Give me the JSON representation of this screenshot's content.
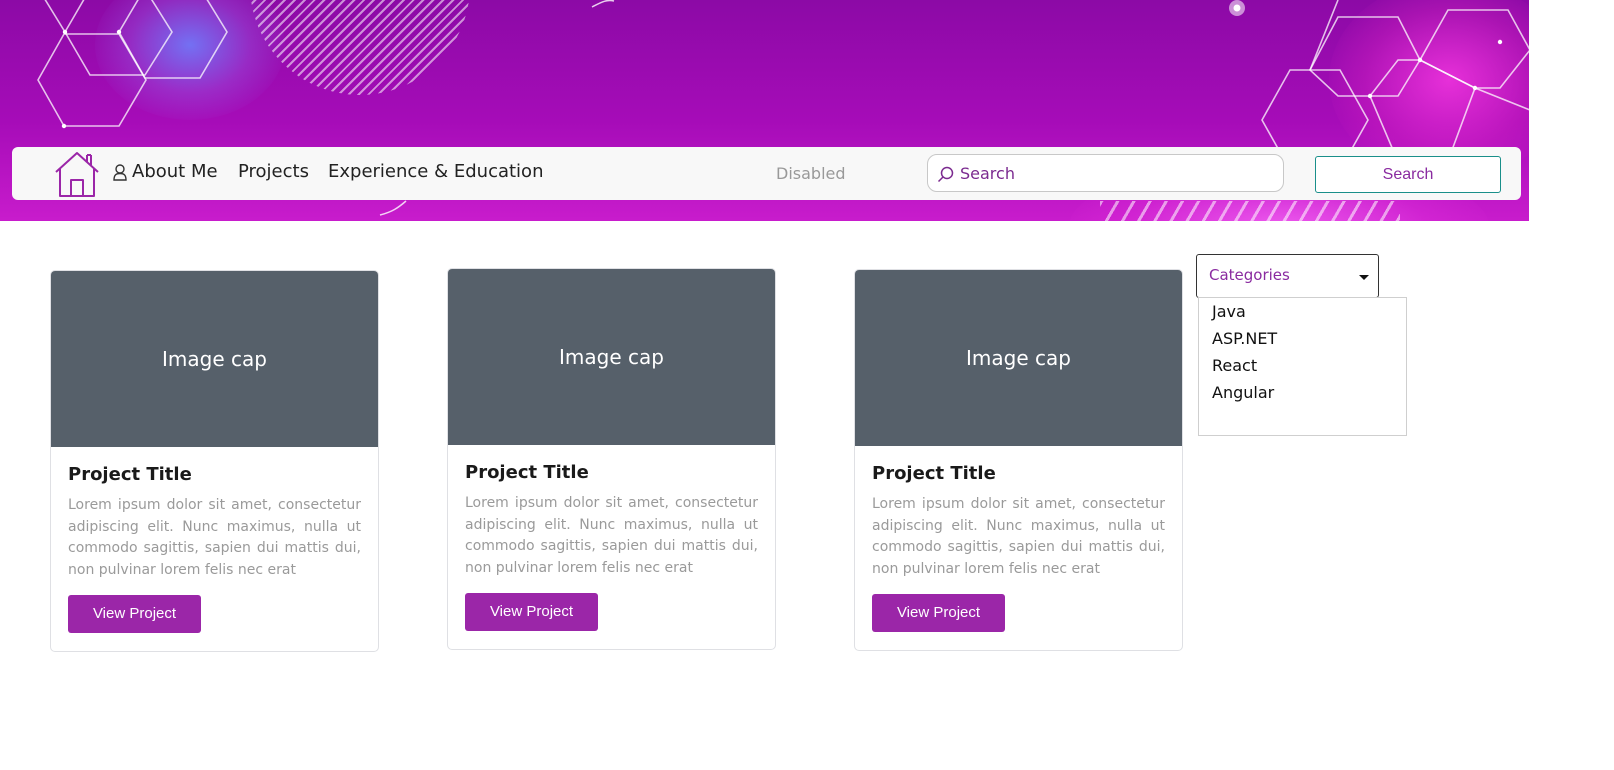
{
  "nav": {
    "home_icon": "house-icon",
    "about_icon": "person-icon",
    "about_label": "About Me",
    "projects_label": "Projects",
    "experience_label": "Experience & Education",
    "disabled_label": "Disabled",
    "search_icon": "search-icon",
    "search_placeholder": "Search",
    "search_button_label": "Search"
  },
  "cards": [
    {
      "image_cap": "Image cap",
      "title": "Project Title",
      "text": "Lorem ipsum dolor sit amet, consectetur adipiscing elit. Nunc maximus, nulla ut commodo sagittis, sapien dui mattis dui, non pulvinar lorem felis nec erat",
      "button_label": "View Project"
    },
    {
      "image_cap": "Image cap",
      "title": "Project Title",
      "text": "Lorem ipsum dolor sit amet, consectetur adipiscing elit. Nunc maximus, nulla ut commodo sagittis, sapien dui mattis dui, non pulvinar lorem felis nec erat",
      "button_label": "View Project"
    },
    {
      "image_cap": "Image cap",
      "title": "Project Title",
      "text": "Lorem ipsum dolor sit amet, consectetur adipiscing elit. Nunc maximus, nulla ut commodo sagittis, sapien dui mattis dui, non pulvinar lorem felis nec erat",
      "button_label": "View Project"
    }
  ],
  "categories": {
    "label": "Categories",
    "caret_icon": "caret-down-icon",
    "options": [
      "Java",
      "ASP.NET",
      "React",
      "Angular"
    ]
  },
  "colors": {
    "banner": "#9a0ab0",
    "accent_purple": "#9b26a8",
    "teal_border": "#1a8f8a",
    "image_cap": "#56606a"
  }
}
